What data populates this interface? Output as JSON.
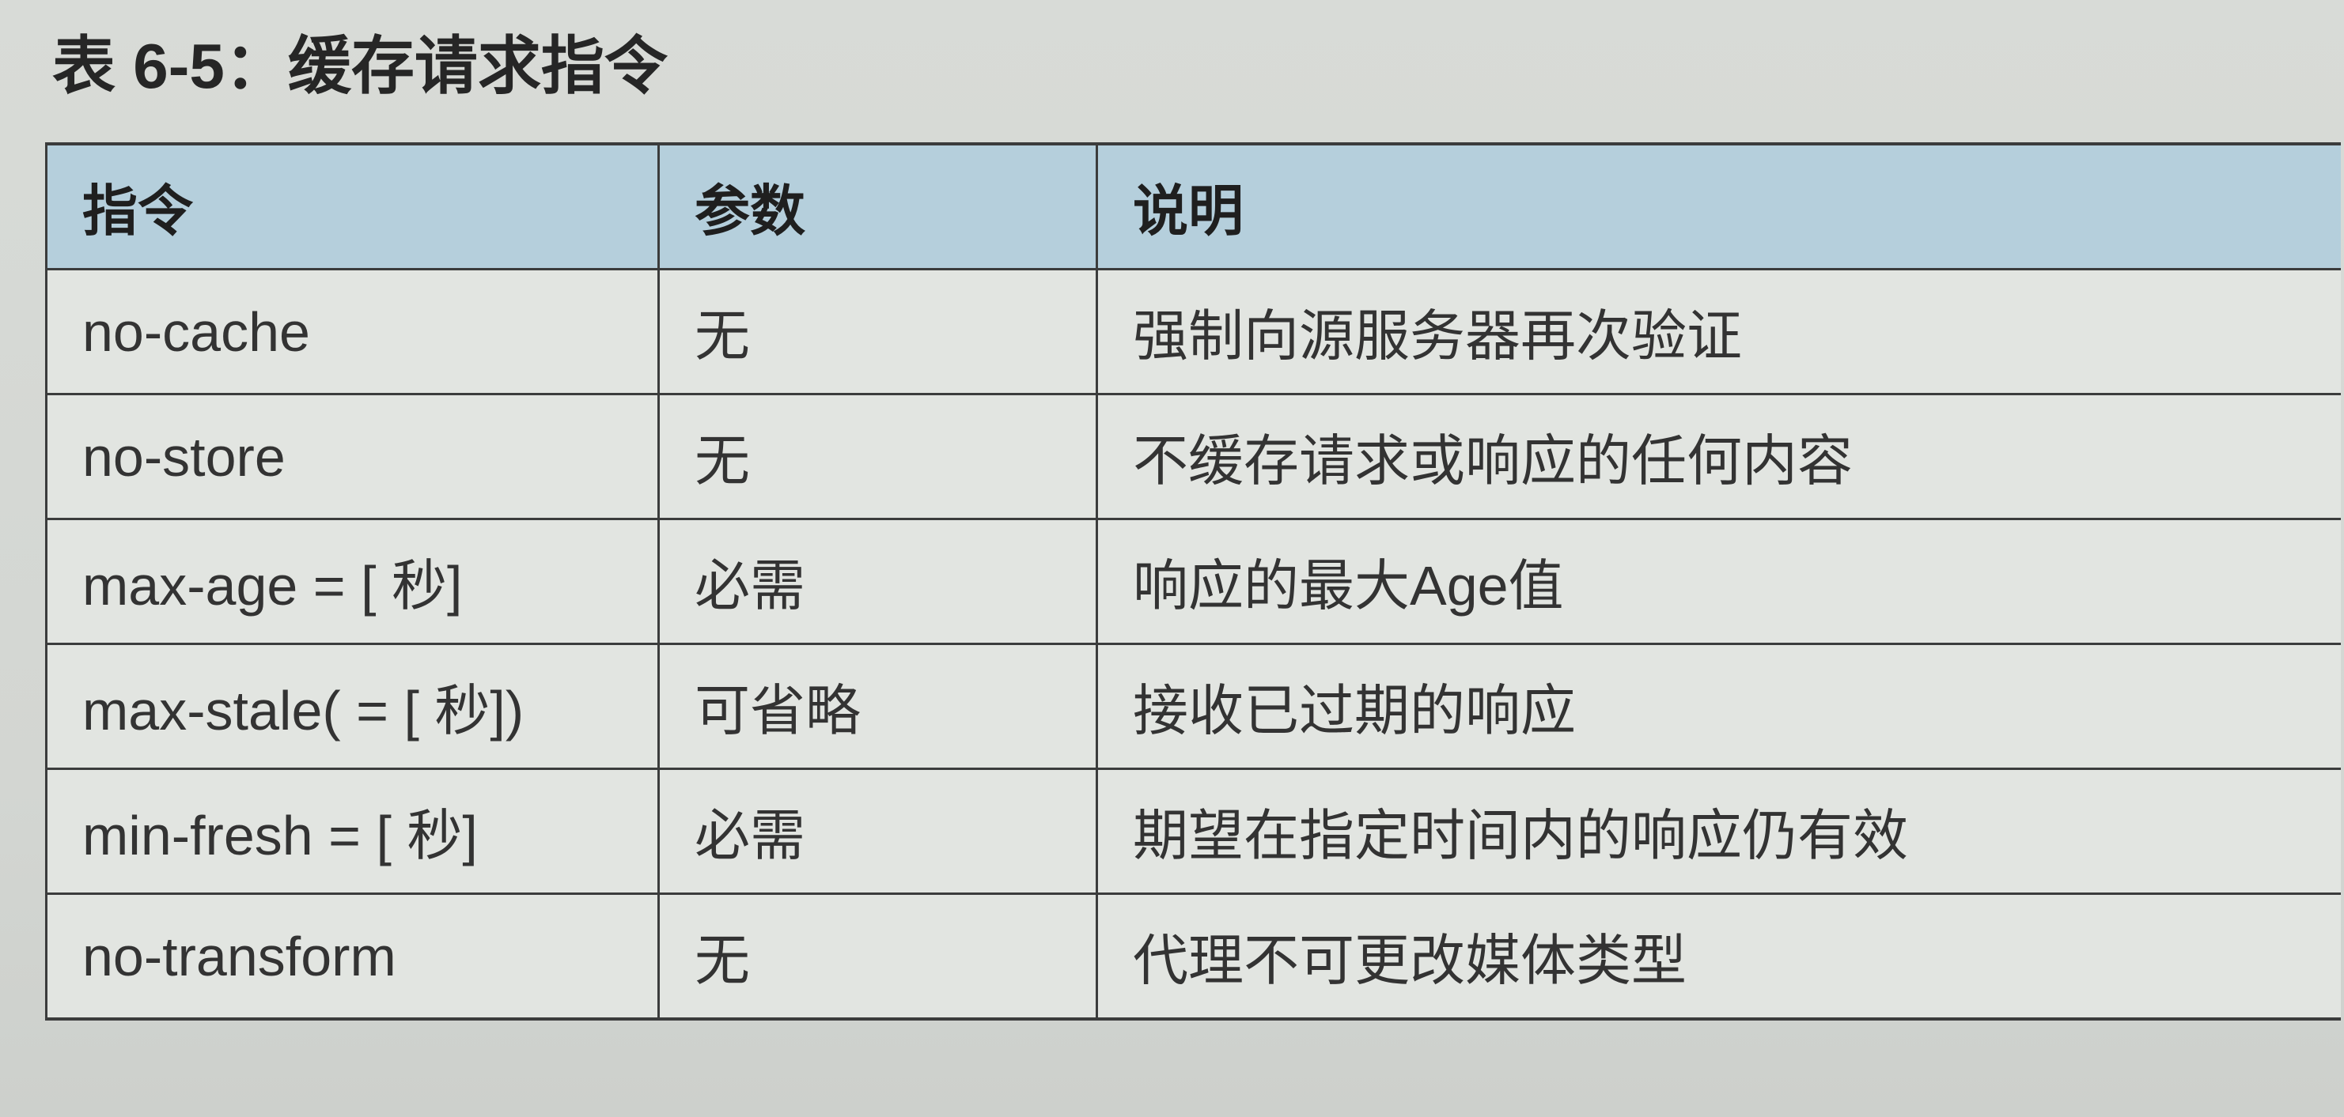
{
  "title": "表 6-5：缓存请求指令",
  "table": {
    "headers": [
      "指令",
      "参数",
      "说明"
    ],
    "rows": [
      [
        "no-cache",
        "无",
        "强制向源服务器再次验证"
      ],
      [
        "no-store",
        "无",
        "不缓存请求或响应的任何内容"
      ],
      [
        "max-age = [ 秒]",
        "必需",
        "响应的最大Age值"
      ],
      [
        "max-stale( = [ 秒])",
        "可省略",
        "接收已过期的响应"
      ],
      [
        "min-fresh = [ 秒]",
        "必需",
        "期望在指定时间内的响应仍有效"
      ],
      [
        "no-transform",
        "无",
        "代理不可更改媒体类型"
      ]
    ]
  },
  "colors": {
    "page_background": "#d8dbd7",
    "header_background": "#b5cfdc",
    "body_background": "#e2e5e1",
    "rule_lines": "#3b3c3c"
  }
}
